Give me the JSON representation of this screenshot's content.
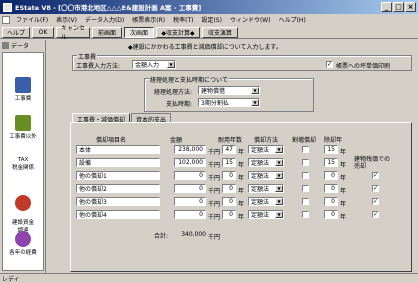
{
  "window": {
    "title": "EState V8 - [〇〇市港北地区△△△E&建設計画 A案 - 工事費]",
    "controls": [
      "_",
      "□",
      "×"
    ]
  },
  "menu": [
    "ファイル(F)",
    "表示(V)",
    "データ入力(D)",
    "帳票表示(R)",
    "税率(T)",
    "設定(S)",
    "ウィンドウ(W)",
    "ヘルプ(H)"
  ],
  "toolbar": {
    "buttons": [
      "ヘルプ",
      "OK",
      "キャンセル",
      "前画面",
      "次画面",
      "◆収支計算◆",
      "収支演算"
    ],
    "active_index": 4
  },
  "sidebar": {
    "header": "データ",
    "items": [
      {
        "label": "工事費",
        "icon": "construction-cost-icon",
        "color": "#3a5fa8"
      },
      {
        "label": "工事費以外",
        "icon": "other-cost-icon",
        "color": "#6b8e23"
      },
      {
        "label": "TAX\n税金関係",
        "icon": "tax-icon",
        "color": "#2e8b57"
      },
      {
        "label": "建設資金\n調達",
        "icon": "funding-icon",
        "color": "#c0392b"
      },
      {
        "label": "各年の経費",
        "icon": "annual-expense-icon",
        "color": "#8e44ad"
      }
    ]
  },
  "main": {
    "info": "◆建設にかかわる工事費と減価償却について入力します。",
    "group1": {
      "title": "工事費",
      "method_label": "工事費入力方法:",
      "method_value": "金額入力",
      "print_checkbox_label": "帳票への坪単価印刷",
      "print_checked": true
    },
    "group2": {
      "title": "経理処理と支払時期について",
      "proc_label": "経理処理方法:",
      "proc_value": "建物償借",
      "pay_label": "支払時期:",
      "pay_value": "3期分割払"
    },
    "tabs": [
      "工事費・減価償却",
      "資本的支出"
    ],
    "table": {
      "headers": [
        "償却項目名",
        "金額",
        "耐用年数",
        "償却方法",
        "割増償却",
        "除却年"
      ],
      "unit": "千円",
      "year_unit": "年",
      "rows": [
        {
          "name": "本体",
          "amount": "238,000",
          "life": "47",
          "method": "定額法",
          "extra": false,
          "retire": "15"
        },
        {
          "name": "設備",
          "amount": "102,000",
          "life": "15",
          "method": "定額法",
          "extra": false,
          "retire": "15"
        },
        {
          "name": "他の償却1",
          "amount": "0",
          "life": "0",
          "method": "定額法",
          "extra": false,
          "retire": "0"
        },
        {
          "name": "他の償却2",
          "amount": "0",
          "life": "0",
          "method": "定額法",
          "extra": false,
          "retire": "0"
        },
        {
          "name": "他の償却3",
          "amount": "0",
          "life": "0",
          "method": "定額法",
          "extra": false,
          "retire": "0"
        },
        {
          "name": "他の償却4",
          "amount": "0",
          "life": "0",
          "method": "定額法",
          "extra": false,
          "retire": "0"
        }
      ],
      "total_label": "合計:",
      "total_value": "340,000",
      "total_unit": "千円",
      "note": "建物残価での\n売却",
      "note_checks": [
        true,
        true,
        true,
        true
      ]
    }
  },
  "statusbar": "レディ"
}
